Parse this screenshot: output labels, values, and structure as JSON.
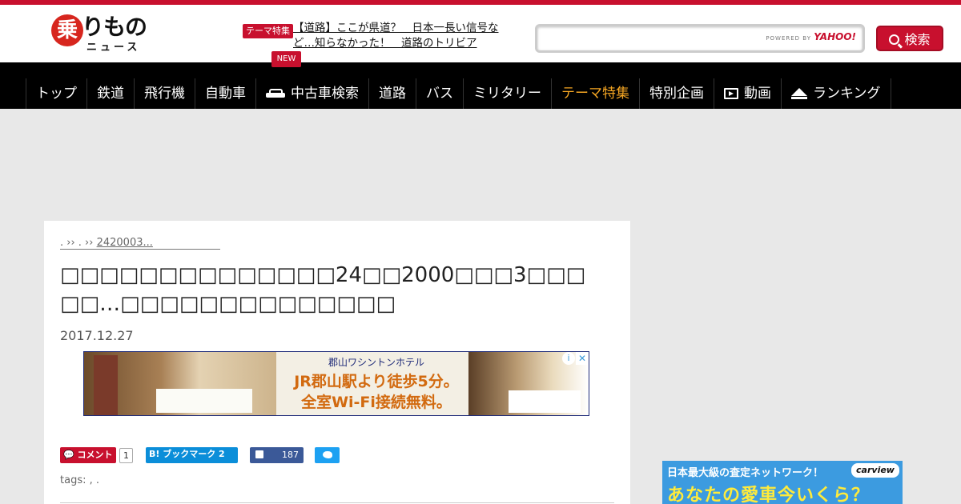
{
  "header": {
    "logo": {
      "mark": "乗",
      "top": "りもの",
      "bottom": "ニュース"
    },
    "feature_badge": "テーマ特集",
    "feature_link": "【道路】ここが県道？　日本一長い信号など…知らなかった！　道路のトリビア",
    "search": {
      "placeholder": "",
      "powered": "POWERED BY",
      "yahoo": "YAHOO!",
      "button": "検索"
    },
    "new_badge": "NEW"
  },
  "nav": {
    "items": [
      {
        "label": "トップ"
      },
      {
        "label": "鉄道"
      },
      {
        "label": "飛行機"
      },
      {
        "label": "自動車"
      },
      {
        "label": "中古車検索",
        "icon": "car-icon"
      },
      {
        "label": "道路"
      },
      {
        "label": "バス"
      },
      {
        "label": "ミリタリー"
      },
      {
        "label": "テーマ特集",
        "active": true
      },
      {
        "label": "特別企画"
      },
      {
        "label": "動画",
        "icon": "video-icon"
      },
      {
        "label": "ランキング",
        "icon": "crown-icon"
      }
    ],
    "active_color": "#f5a623"
  },
  "article": {
    "breadcrumb": "2420003...",
    "breadcrumb_prefix": ". ›› . ›› ",
    "title": "□□□□□□□□□□□□□□24□□2000□□□3□□□□□…□□□□□□□□□□□□□□",
    "date": "2017.12.27",
    "ad": {
      "hotel": "郡山ワシントンホテル",
      "copy1": "JR郡山駅より徒歩5分。",
      "copy2": "全室Wi-Fi接続無料。",
      "info": "i",
      "close": "✕"
    },
    "share": {
      "comment_label": "コメント",
      "comment_count": "1",
      "hatena_label": "B! ブックマーク 2",
      "fb_count": "187"
    },
    "tags_label": "tags: , ."
  },
  "side_ad": {
    "line1": "日本最大級の査定ネットワーク！",
    "line2": "あなたの愛車今いくら？",
    "logo": "carview"
  },
  "colors": {
    "brand": "#c8102e",
    "nav_bg": "#000000",
    "page_bg": "#e8e8e8"
  }
}
